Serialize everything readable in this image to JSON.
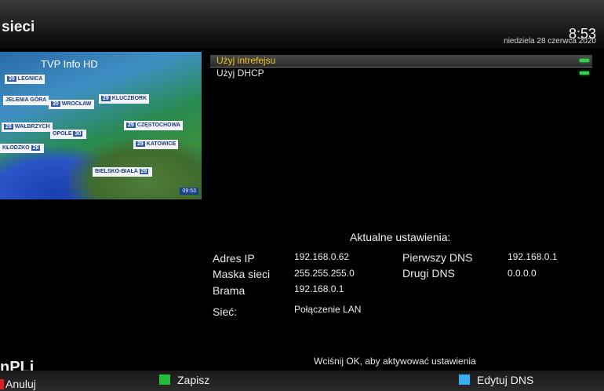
{
  "header": {
    "title": "sieci",
    "time": "8:53",
    "date": "niedziela 28 czerwca 2020"
  },
  "preview": {
    "channel": "TVP Info HD",
    "clock": "09:53",
    "cities": [
      {
        "temp": "30",
        "name": "LEGNICA"
      },
      {
        "temp": "29",
        "name": "KLUCZBORK"
      },
      {
        "temp": "",
        "name": "JELENIA GÓRA"
      },
      {
        "temp": "30",
        "name": "WROCŁAW"
      },
      {
        "temp": "29",
        "name": "WAŁBRZYCH"
      },
      {
        "temp": "30",
        "name": "OPOLE"
      },
      {
        "temp": "29",
        "name": "CZĘSTOCHOWA"
      },
      {
        "temp": "28",
        "name": "KŁODZKO"
      },
      {
        "temp": "29",
        "name": "KATOWICE"
      },
      {
        "temp": "29",
        "name": "BIELSKO-BIAŁA"
      }
    ]
  },
  "menu": {
    "items": [
      {
        "label": "Użyj intrefejsu",
        "selected": true
      },
      {
        "label": "Użyj DHCP",
        "selected": false
      }
    ]
  },
  "settings": {
    "title": "Aktualne ustawienia:",
    "ip_label": "Adres IP",
    "ip_value": "192.168.0.62",
    "mask_label": "Maska sieci",
    "mask_value": "255.255.255.0",
    "gateway_label": "Brama",
    "gateway_value": "192.168.0.1",
    "dns1_label": "Pierwszy DNS",
    "dns1_value": "192.168.0.1",
    "dns2_label": "Drugi DNS",
    "dns2_value": "0.0.0.0",
    "network_label": "Sieć:",
    "network_value": "Połączenie LAN"
  },
  "hint": "Wciśnij OK, aby aktywować ustawienia",
  "logo": "nPLi",
  "footer": {
    "red_label": "Anuluj",
    "green_label": "Zapisz",
    "blue_label": "Edytuj DNS"
  },
  "colors": {
    "selected_text": "#f3c31a",
    "led": "#34d24a",
    "key_red": "#e02020",
    "key_green": "#22c03a",
    "key_blue": "#38aef0"
  }
}
